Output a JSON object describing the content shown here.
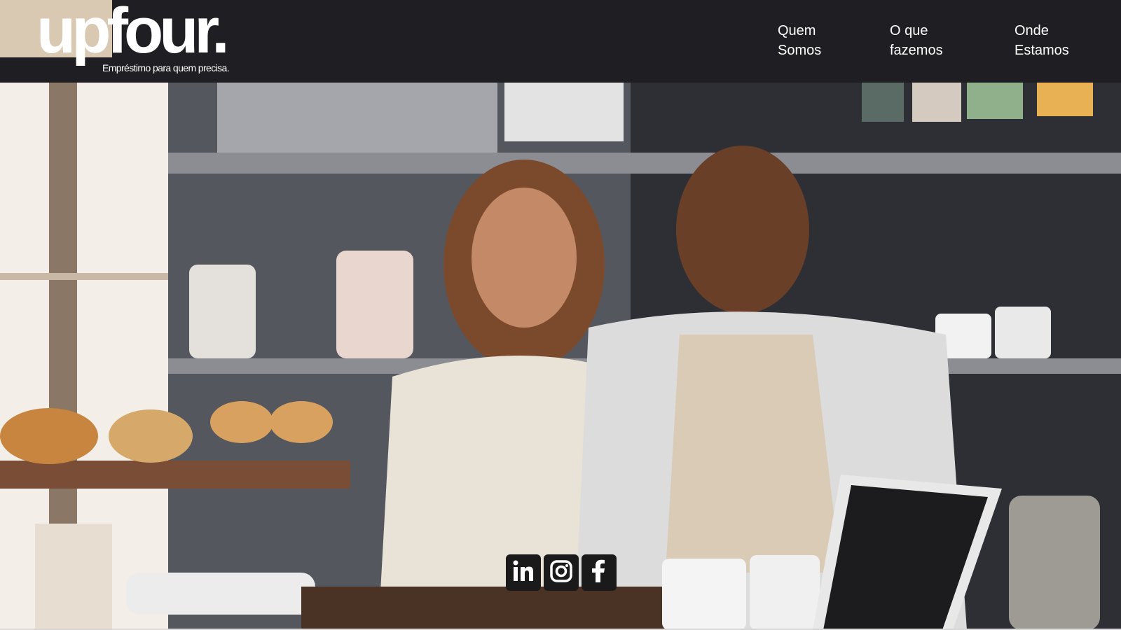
{
  "header": {
    "logo_text": "upfour.",
    "logo_tagline": "Empréstimo para quem precisa."
  },
  "nav": {
    "items": [
      {
        "line1": "Quem",
        "line2": "Somos"
      },
      {
        "line1": "O que",
        "line2": "fazemos"
      },
      {
        "line1": "Onde",
        "line2": "Estamos"
      }
    ]
  },
  "hero": {
    "image": "smiling-couple-cafe-owners-photo"
  },
  "social": {
    "icons": [
      "linkedin-icon",
      "instagram-icon",
      "facebook-icon"
    ]
  },
  "colors": {
    "header_bg": "#1f1f23",
    "logo_block": "#d9c9b3",
    "text_light": "#ffffff",
    "social_bg": "#1a1a1a"
  }
}
